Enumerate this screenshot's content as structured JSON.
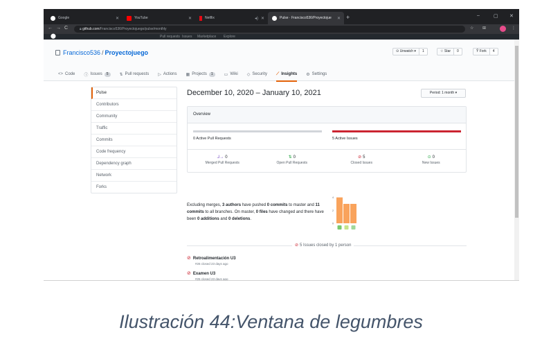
{
  "browser": {
    "tabs": [
      {
        "label": "Google",
        "color": "#ffffff"
      },
      {
        "label": "YouTube",
        "color": "#ff0000"
      },
      {
        "label": "Netflix",
        "color": "#e50914"
      },
      {
        "label": "Pulse · Francisco536/Proyectojue",
        "color": "#ffffff"
      }
    ],
    "new_tab": "+",
    "window_controls": [
      "–",
      "▢",
      "✕"
    ],
    "url_host": "github.com",
    "url_path": "/Francisco536/Proyectojuego/pulse/monthly",
    "nav": [
      "←",
      "→",
      "C"
    ],
    "toolbar_icons": [
      "☆",
      "⊞"
    ]
  },
  "gh_header": [
    "Pull requests",
    "Issues",
    "Marketplace",
    "Explore"
  ],
  "repo": {
    "owner": "Francisco536",
    "separator": "/",
    "name": "Proyectojuego",
    "unwatch": "⊙ Unwatch ▾",
    "unwatch_count": "1",
    "star": "☆ Star",
    "star_count": "0",
    "fork": "Ŷ Fork",
    "fork_count": "4",
    "nav": [
      {
        "icon": "<>",
        "label": "Code",
        "count": ""
      },
      {
        "icon": "ⓘ",
        "label": "Issues",
        "count": "5"
      },
      {
        "icon": "⇅",
        "label": "Pull requests",
        "count": ""
      },
      {
        "icon": "▷",
        "label": "Actions",
        "count": ""
      },
      {
        "icon": "▦",
        "label": "Projects",
        "count": "1"
      },
      {
        "icon": "▭",
        "label": "Wiki",
        "count": ""
      },
      {
        "icon": "◇",
        "label": "Security",
        "count": ""
      },
      {
        "icon": "⟋",
        "label": "Insights",
        "count": ""
      },
      {
        "icon": "⚙",
        "label": "Settings",
        "count": ""
      }
    ]
  },
  "sidebar": [
    "Pulse",
    "Contributors",
    "Community",
    "Traffic",
    "Commits",
    "Code frequency",
    "Dependency graph",
    "Network",
    "Forks"
  ],
  "main": {
    "date_range": "December 10, 2020 – January 10, 2021",
    "period": "Period: 1 month ▾",
    "overview_title": "Overview",
    "active_prs": "0 Active Pull Requests",
    "active_issues": "5 Active Issues",
    "pr_bar_fraction": 0,
    "issue_bar_fraction": 1,
    "colors": {
      "pr_fill": "#6f42c1",
      "issue_fill": "#cb2431",
      "track": "#d1d5da",
      "commit_bar": "#f9a35c"
    },
    "stats": [
      {
        "icon": "⅃→",
        "num": "0",
        "label": "Merged Pull Requests",
        "color": "#6f42c1"
      },
      {
        "icon": "⇅",
        "num": "0",
        "label": "Open Pull Requests",
        "color": "#28a745"
      },
      {
        "icon": "⊘",
        "num": "5",
        "label": "Closed Issues",
        "color": "#cb2431"
      },
      {
        "icon": "⊙",
        "num": "0",
        "label": "New Issues",
        "color": "#28a745"
      }
    ],
    "summary": {
      "t1": "Excluding merges, ",
      "authors": "3 authors",
      "t2": " have pushed ",
      "commits_master": "0 commits",
      "t3": " to master and ",
      "commits_all": "11 commits",
      "t4": " to all branches. On master, ",
      "files": "0 files",
      "t5": " have changed and there have been ",
      "additions": "0 additions",
      "t6": " and ",
      "deletions": "0 deletions",
      "t7": "."
    },
    "closed_heading": "5 Issues closed by 1 person",
    "closed_icon": "⊘",
    "issues": [
      {
        "title": "Retroalimentación U3",
        "meta": "#26 closed 23 days ago"
      },
      {
        "title": "Examen U3",
        "meta": "#25 closed 23 days ago"
      }
    ]
  },
  "chart_data": {
    "type": "bar",
    "categories": [
      "author 1",
      "author 2",
      "author 3"
    ],
    "values": [
      4,
      3,
      3
    ],
    "ylim": [
      0,
      4.5
    ],
    "yticks": [
      "4",
      "2",
      "0"
    ],
    "grid": false
  },
  "caption": "Ilustración 44:Ventana de legumbres"
}
